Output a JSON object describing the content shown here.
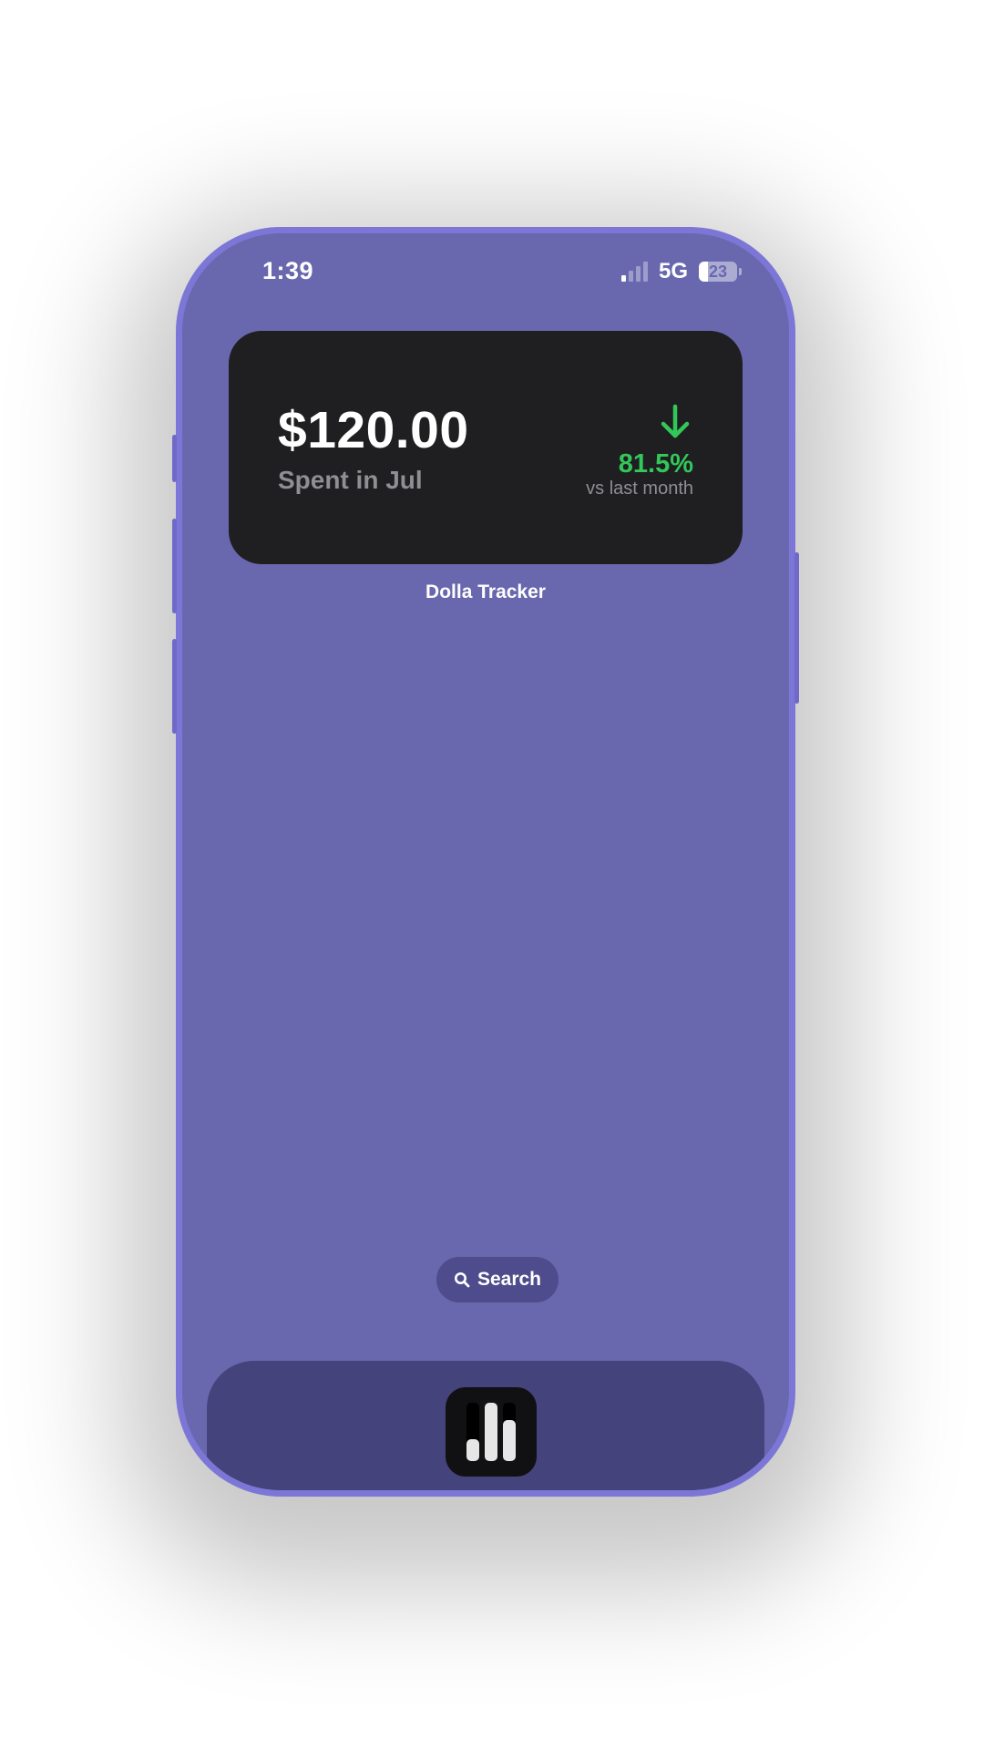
{
  "status_bar": {
    "time": "1:39",
    "network": "5G",
    "battery_level": "23",
    "battery_fraction": 0.23,
    "signal_bars_active": 1,
    "signal_bars_total": 4
  },
  "widget": {
    "amount": "$120.00",
    "label": "Spent in Jul",
    "trend_direction": "down",
    "trend_icon": "arrow-down-icon",
    "percent": "81.5%",
    "comparison": "vs last month",
    "caption": "Dolla Tracker"
  },
  "search": {
    "label": "Search",
    "icon": "search-icon"
  },
  "dock": {
    "app_icon": "bar-chart-icon"
  },
  "colors": {
    "frame": "#7c77d6",
    "wallpaper": "#6968af",
    "widget_bg": "#1f1f21",
    "accent_green": "#33c75a",
    "secondary_text": "#8e8e93",
    "dock_bg": "#45437b"
  }
}
